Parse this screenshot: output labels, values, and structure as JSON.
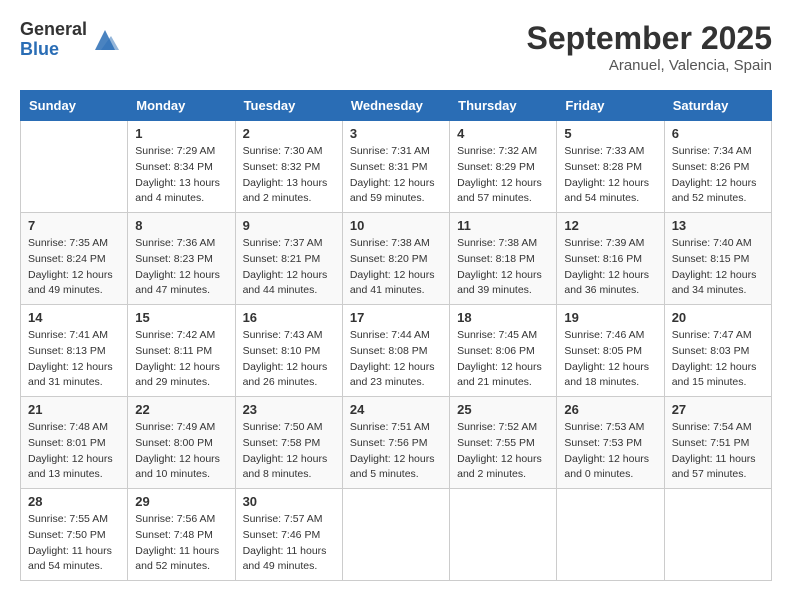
{
  "header": {
    "logo_general": "General",
    "logo_blue": "Blue",
    "month_title": "September 2025",
    "location": "Aranuel, Valencia, Spain"
  },
  "weekdays": [
    "Sunday",
    "Monday",
    "Tuesday",
    "Wednesday",
    "Thursday",
    "Friday",
    "Saturday"
  ],
  "weeks": [
    [
      {
        "day": "",
        "info": ""
      },
      {
        "day": "1",
        "info": "Sunrise: 7:29 AM\nSunset: 8:34 PM\nDaylight: 13 hours\nand 4 minutes."
      },
      {
        "day": "2",
        "info": "Sunrise: 7:30 AM\nSunset: 8:32 PM\nDaylight: 13 hours\nand 2 minutes."
      },
      {
        "day": "3",
        "info": "Sunrise: 7:31 AM\nSunset: 8:31 PM\nDaylight: 12 hours\nand 59 minutes."
      },
      {
        "day": "4",
        "info": "Sunrise: 7:32 AM\nSunset: 8:29 PM\nDaylight: 12 hours\nand 57 minutes."
      },
      {
        "day": "5",
        "info": "Sunrise: 7:33 AM\nSunset: 8:28 PM\nDaylight: 12 hours\nand 54 minutes."
      },
      {
        "day": "6",
        "info": "Sunrise: 7:34 AM\nSunset: 8:26 PM\nDaylight: 12 hours\nand 52 minutes."
      }
    ],
    [
      {
        "day": "7",
        "info": "Sunrise: 7:35 AM\nSunset: 8:24 PM\nDaylight: 12 hours\nand 49 minutes."
      },
      {
        "day": "8",
        "info": "Sunrise: 7:36 AM\nSunset: 8:23 PM\nDaylight: 12 hours\nand 47 minutes."
      },
      {
        "day": "9",
        "info": "Sunrise: 7:37 AM\nSunset: 8:21 PM\nDaylight: 12 hours\nand 44 minutes."
      },
      {
        "day": "10",
        "info": "Sunrise: 7:38 AM\nSunset: 8:20 PM\nDaylight: 12 hours\nand 41 minutes."
      },
      {
        "day": "11",
        "info": "Sunrise: 7:38 AM\nSunset: 8:18 PM\nDaylight: 12 hours\nand 39 minutes."
      },
      {
        "day": "12",
        "info": "Sunrise: 7:39 AM\nSunset: 8:16 PM\nDaylight: 12 hours\nand 36 minutes."
      },
      {
        "day": "13",
        "info": "Sunrise: 7:40 AM\nSunset: 8:15 PM\nDaylight: 12 hours\nand 34 minutes."
      }
    ],
    [
      {
        "day": "14",
        "info": "Sunrise: 7:41 AM\nSunset: 8:13 PM\nDaylight: 12 hours\nand 31 minutes."
      },
      {
        "day": "15",
        "info": "Sunrise: 7:42 AM\nSunset: 8:11 PM\nDaylight: 12 hours\nand 29 minutes."
      },
      {
        "day": "16",
        "info": "Sunrise: 7:43 AM\nSunset: 8:10 PM\nDaylight: 12 hours\nand 26 minutes."
      },
      {
        "day": "17",
        "info": "Sunrise: 7:44 AM\nSunset: 8:08 PM\nDaylight: 12 hours\nand 23 minutes."
      },
      {
        "day": "18",
        "info": "Sunrise: 7:45 AM\nSunset: 8:06 PM\nDaylight: 12 hours\nand 21 minutes."
      },
      {
        "day": "19",
        "info": "Sunrise: 7:46 AM\nSunset: 8:05 PM\nDaylight: 12 hours\nand 18 minutes."
      },
      {
        "day": "20",
        "info": "Sunrise: 7:47 AM\nSunset: 8:03 PM\nDaylight: 12 hours\nand 15 minutes."
      }
    ],
    [
      {
        "day": "21",
        "info": "Sunrise: 7:48 AM\nSunset: 8:01 PM\nDaylight: 12 hours\nand 13 minutes."
      },
      {
        "day": "22",
        "info": "Sunrise: 7:49 AM\nSunset: 8:00 PM\nDaylight: 12 hours\nand 10 minutes."
      },
      {
        "day": "23",
        "info": "Sunrise: 7:50 AM\nSunset: 7:58 PM\nDaylight: 12 hours\nand 8 minutes."
      },
      {
        "day": "24",
        "info": "Sunrise: 7:51 AM\nSunset: 7:56 PM\nDaylight: 12 hours\nand 5 minutes."
      },
      {
        "day": "25",
        "info": "Sunrise: 7:52 AM\nSunset: 7:55 PM\nDaylight: 12 hours\nand 2 minutes."
      },
      {
        "day": "26",
        "info": "Sunrise: 7:53 AM\nSunset: 7:53 PM\nDaylight: 12 hours\nand 0 minutes."
      },
      {
        "day": "27",
        "info": "Sunrise: 7:54 AM\nSunset: 7:51 PM\nDaylight: 11 hours\nand 57 minutes."
      }
    ],
    [
      {
        "day": "28",
        "info": "Sunrise: 7:55 AM\nSunset: 7:50 PM\nDaylight: 11 hours\nand 54 minutes."
      },
      {
        "day": "29",
        "info": "Sunrise: 7:56 AM\nSunset: 7:48 PM\nDaylight: 11 hours\nand 52 minutes."
      },
      {
        "day": "30",
        "info": "Sunrise: 7:57 AM\nSunset: 7:46 PM\nDaylight: 11 hours\nand 49 minutes."
      },
      {
        "day": "",
        "info": ""
      },
      {
        "day": "",
        "info": ""
      },
      {
        "day": "",
        "info": ""
      },
      {
        "day": "",
        "info": ""
      }
    ]
  ]
}
